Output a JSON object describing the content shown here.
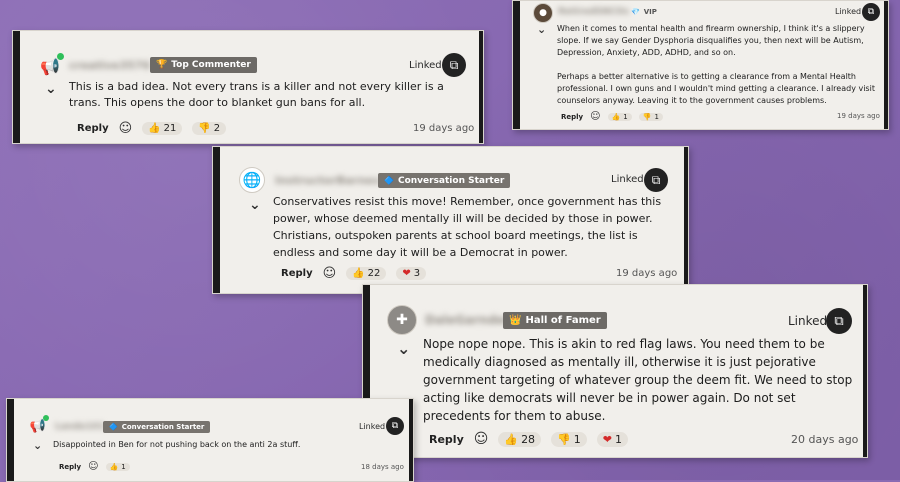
{
  "comments": [
    {
      "id": "c1",
      "username": "creative3576",
      "badge": "Top Commenter",
      "badge_icon": "🏆",
      "linked": "Linked",
      "text": "This is a bad idea. Not every trans is a killer and not every killer is a trans. This opens the door to blanket gun bans for all.",
      "reply": "Reply",
      "reactions": [
        {
          "icon": "👍",
          "count": "21"
        },
        {
          "icon": "👎",
          "count": "2"
        }
      ],
      "ago": "19 days ago"
    },
    {
      "id": "c2",
      "username": "RetiredSNCOs",
      "badge": "VIP",
      "badge_icon": "💎",
      "linked": "Linked",
      "text": "When it comes to mental health and firearm ownership, I think it's a slippery slope. If we say Gender Dysphoria disqualifies you, then next will be Autism, Depression, Anxiety, ADD, ADHD, and so on.",
      "text2": "Perhaps a better alternative is to getting a clearance from a Mental Health professional. I own guns and I wouldn't mind getting a clearance. I already visit counselors anyway. Leaving it to the government causes problems.",
      "reply": "Reply",
      "reactions": [
        {
          "icon": "👍",
          "count": "1"
        },
        {
          "icon": "👎",
          "count": "1"
        }
      ],
      "ago": "19 days ago"
    },
    {
      "id": "c3",
      "username": "InstructorBarnes",
      "badge": "Conversation Starter",
      "badge_icon": "🔷",
      "linked": "Linked",
      "text": "Conservatives resist this move! Remember, once government has this power, whose deemed mentally ill will be decided by those in power. Christians, outspoken parents at school board meetings, the list is endless and some day it will be a Democrat in power.",
      "reply": "Reply",
      "reactions": [
        {
          "icon": "👍",
          "count": "22"
        },
        {
          "icon": "❤",
          "count": "3"
        }
      ],
      "ago": "19 days ago"
    },
    {
      "id": "c4",
      "username": "DaleGarnder",
      "badge": "Hall of Famer",
      "badge_icon": "👑",
      "linked": "Linked",
      "text": "Nope nope nope. This is akin to red flag laws. You need them to be medically diagnosed as mentally ill, otherwise it is just pejorative government targeting of whatever group the deem fit. We need to stop acting like democrats will never be in power again. Do not set precedents for them to abuse.",
      "reply": "Reply",
      "reactions": [
        {
          "icon": "👍",
          "count": "28"
        },
        {
          "icon": "👎",
          "count": "1"
        },
        {
          "icon": "❤",
          "count": "1"
        }
      ],
      "ago": "20 days ago"
    },
    {
      "id": "c5",
      "username": "Lando101",
      "badge": "Conversation Starter",
      "badge_icon": "🔷",
      "linked": "Linked",
      "text": "Disappointed in Ben for not pushing back on the anti 2a stuff.",
      "reply": "Reply",
      "reactions": [
        {
          "icon": "👍",
          "count": "1"
        }
      ],
      "ago": "18 days ago"
    }
  ]
}
